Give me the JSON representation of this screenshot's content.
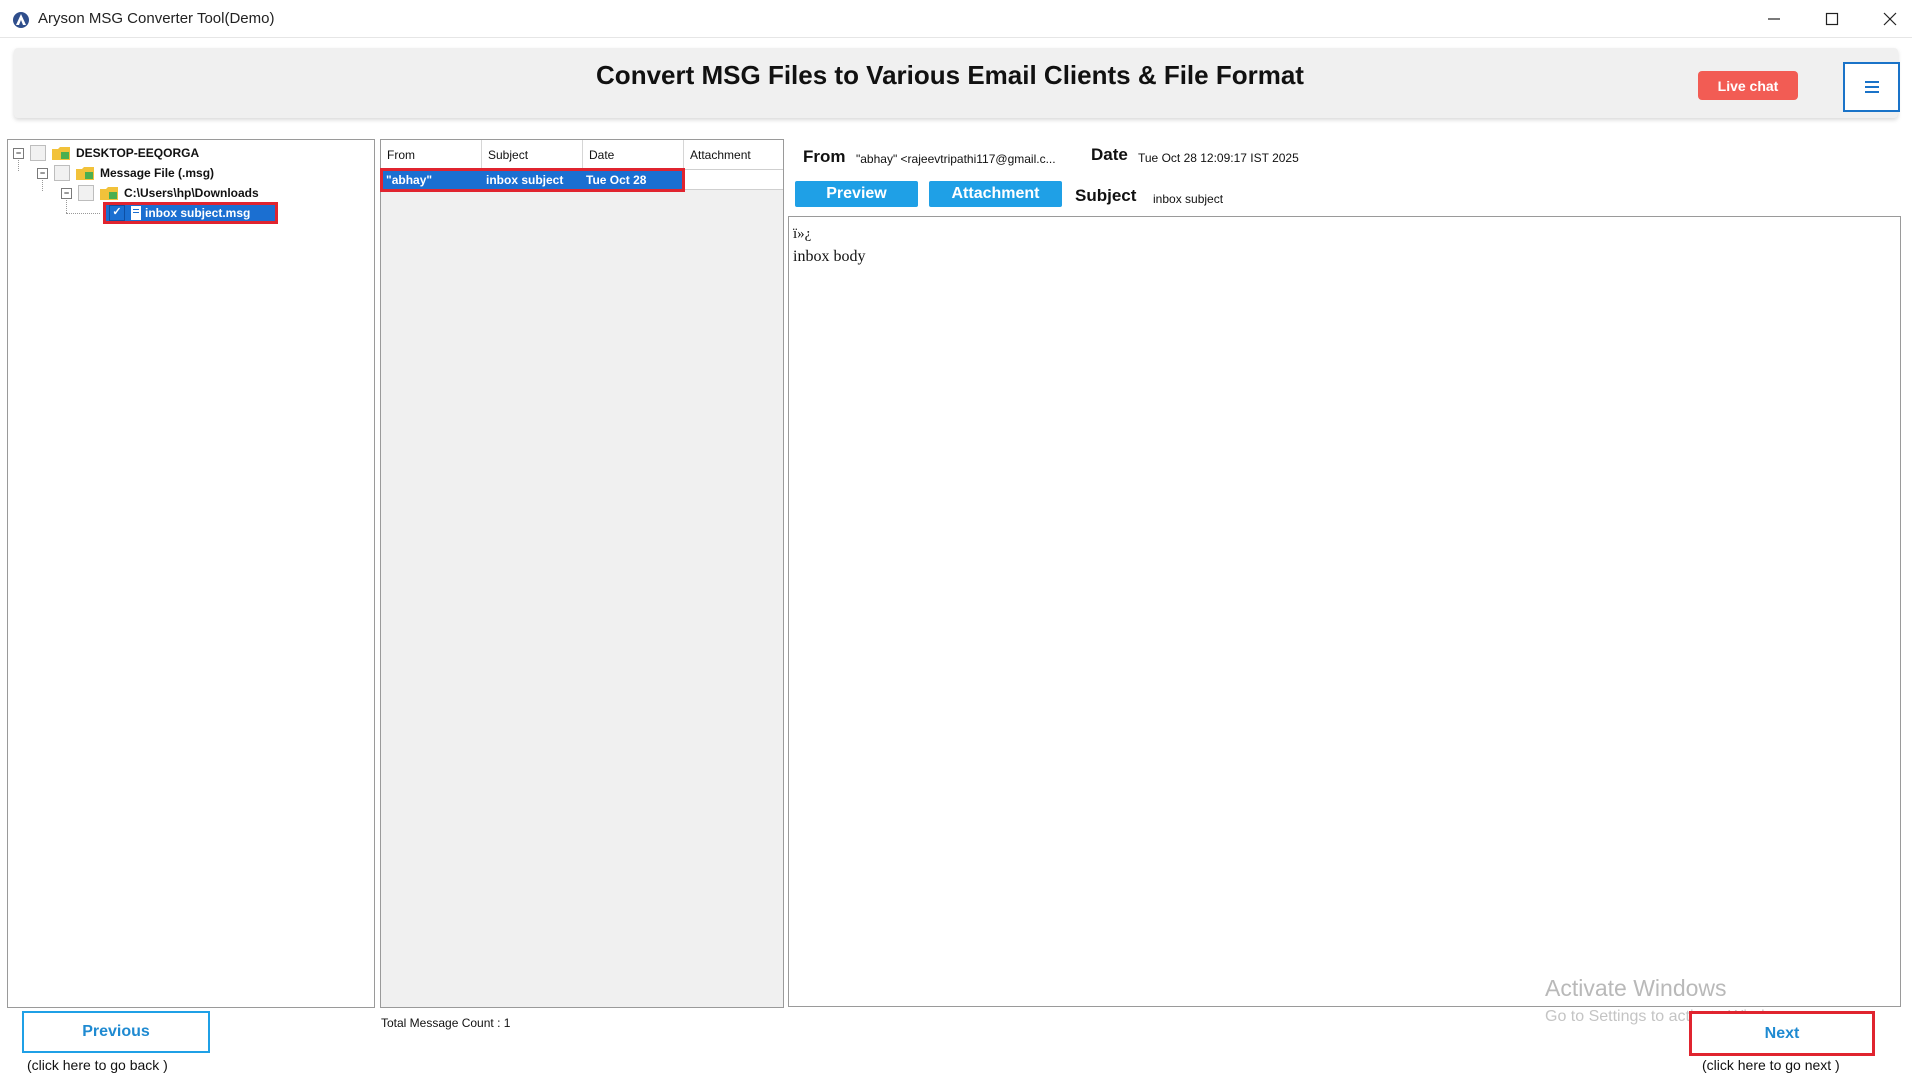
{
  "window": {
    "title": "Aryson MSG Converter Tool(Demo)"
  },
  "banner": {
    "title": "Convert MSG Files to Various Email Clients & File Format",
    "live_chat": "Live chat",
    "menu_icon": "hamburger-icon"
  },
  "tree": {
    "root": "DESKTOP-EEQORGA",
    "message_file": "Message File (.msg)",
    "folder_path": "C:\\Users\\hp\\Downloads",
    "file": "inbox subject.msg"
  },
  "list": {
    "columns": [
      "From",
      "Subject",
      "Date",
      "Attachment"
    ],
    "rows": [
      {
        "from": "\"abhay\"",
        "subject": "inbox subject",
        "date": "Tue Oct 28",
        "attachment": ""
      }
    ],
    "total_count": "Total Message Count : 1"
  },
  "preview": {
    "from_label": "From",
    "from_value": "\"abhay\" <rajeevtripathi117@gmail.c...",
    "date_label": "Date",
    "date_value": "Tue Oct 28 12:09:17 IST 2025",
    "preview_btn": "Preview",
    "attachment_btn": "Attachment",
    "subject_label": "Subject",
    "subject_value": "inbox subject",
    "body_bom": "ï»¿",
    "body_text": "inbox body"
  },
  "nav": {
    "previous": "Previous",
    "previous_hint": "(click here to  go back )",
    "next": "Next",
    "next_hint": "(click here to  go next )"
  },
  "watermark": {
    "title": "Activate Windows",
    "subtitle": "Go to Settings to activate Windows."
  },
  "colors": {
    "accent_blue": "#1fa0e6",
    "selection_blue": "#1b6fd1",
    "highlight_red": "#e0242f",
    "live_chat": "#f25c54"
  }
}
